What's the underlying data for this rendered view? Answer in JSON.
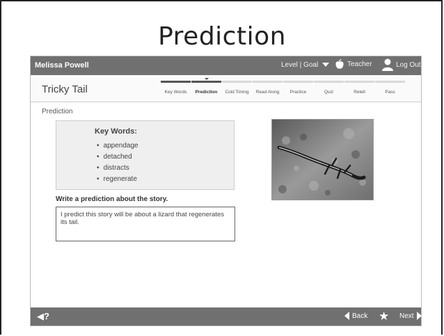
{
  "slide": {
    "title": "Prediction"
  },
  "topbar": {
    "user_name": "Melissa Powell",
    "level_goal": "Level | Goal",
    "teacher": "Teacher",
    "logout": "Log Out"
  },
  "story": {
    "title": "Tricky Tail"
  },
  "steps": [
    {
      "label": "Key Words",
      "state": "done"
    },
    {
      "label": "Prediction",
      "state": "active"
    },
    {
      "label": "Cold Timing",
      "state": "todo"
    },
    {
      "label": "Read Along",
      "state": "todo"
    },
    {
      "label": "Practice",
      "state": "todo"
    },
    {
      "label": "Quiz",
      "state": "todo"
    },
    {
      "label": "Retell",
      "state": "todo"
    },
    {
      "label": "Pass",
      "state": "todo"
    }
  ],
  "main": {
    "section_label": "Prediction",
    "key_words_title": "Key Words:",
    "key_words": [
      "appendage",
      "detached",
      "distracts",
      "regenerate"
    ],
    "prompt": "Write a prediction about the story.",
    "answer": "I predict this story will be about a lizard that regenerates its tail."
  },
  "bottombar": {
    "audio_help": "◀?",
    "back": "Back",
    "next": "Next"
  }
}
